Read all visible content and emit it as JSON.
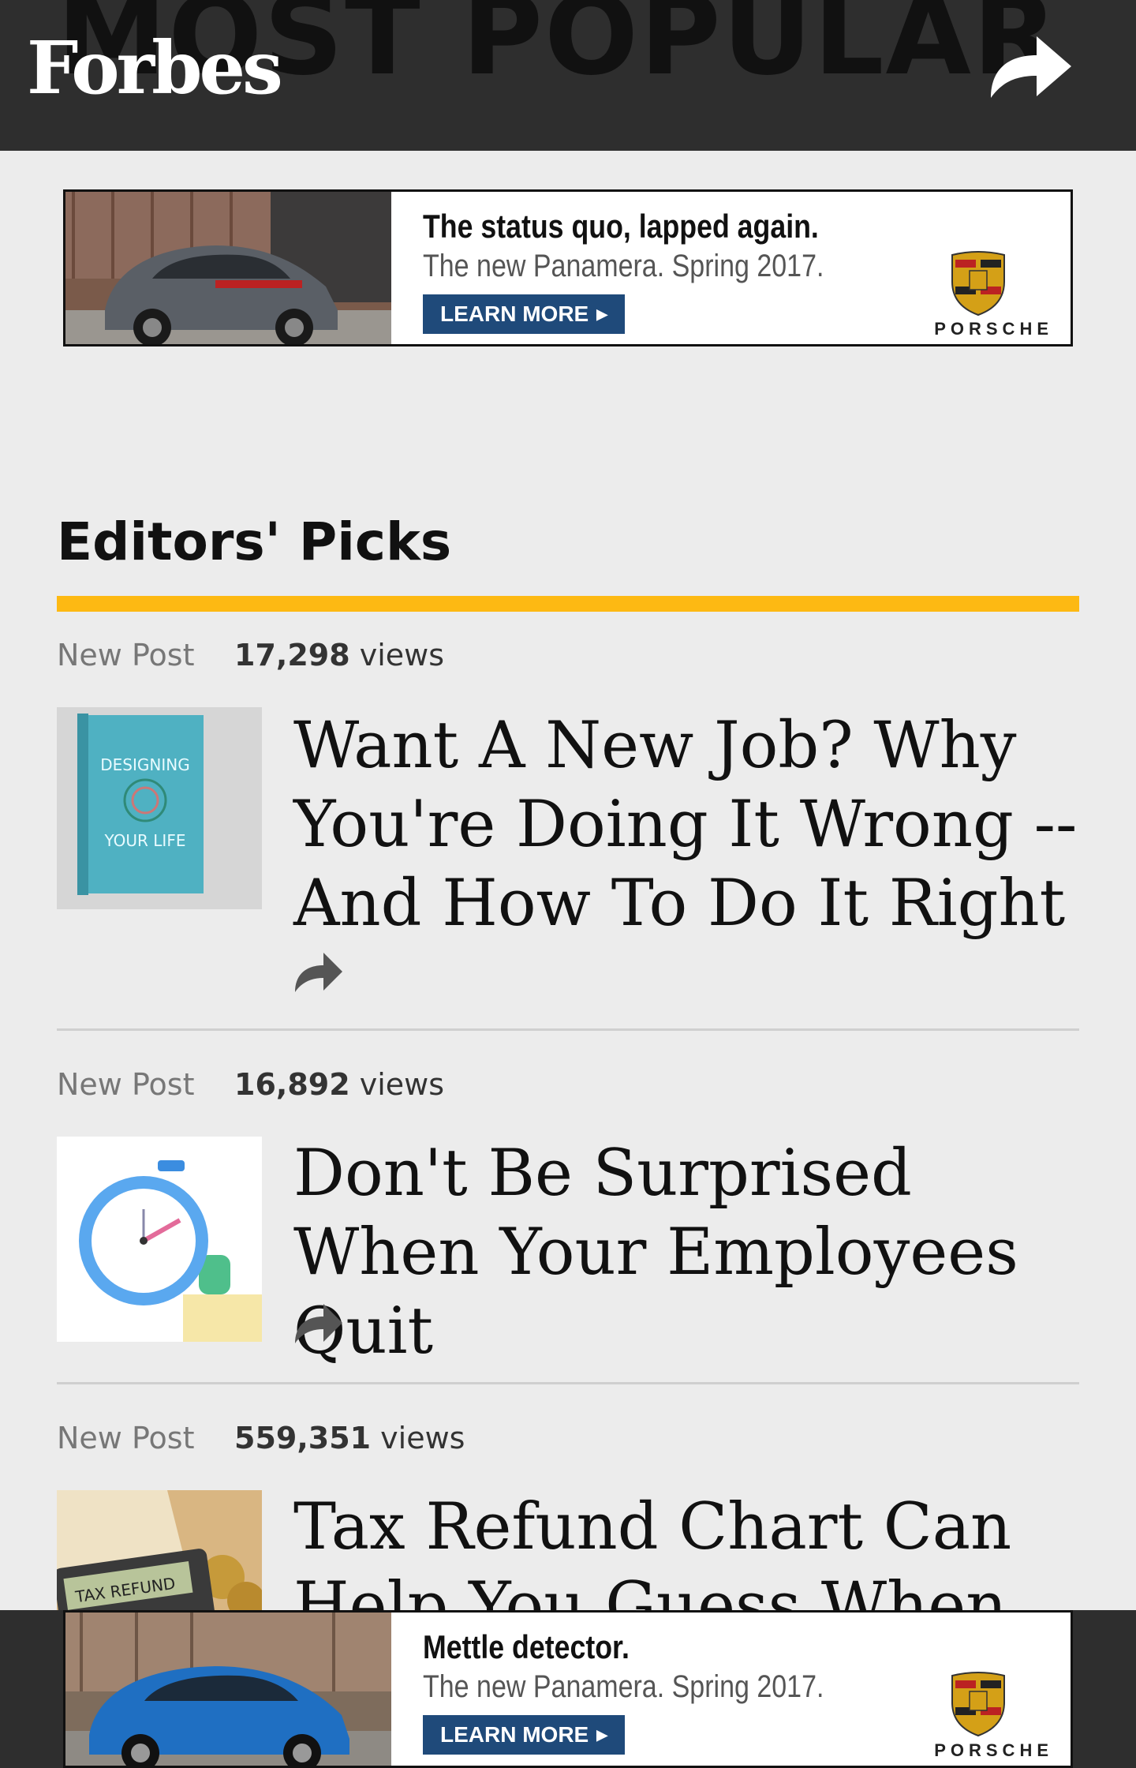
{
  "header": {
    "background_title": "MOST POPULAR",
    "logo": "Forbes",
    "share_icon": "share-arrow-icon"
  },
  "ads": [
    {
      "headline": "The status quo, lapped again.",
      "subline": "The new Panamera. Spring 2017.",
      "cta": "LEARN MORE",
      "brand": "PORSCHE",
      "car_color": "#5a5f66"
    },
    {
      "headline": "Mettle detector.",
      "subline": "The new Panamera. Spring 2017.",
      "cta": "LEARN MORE",
      "brand": "PORSCHE",
      "car_color": "#1f6fc2"
    }
  ],
  "editors_picks": {
    "title": "Editors' Picks",
    "accent_color": "#fdb913",
    "articles": [
      {
        "label": "New Post",
        "views_count": "17,298",
        "views_word": "views",
        "headline": "Want A New Job? Why You're Doing It Wrong -- And How To Do It Right",
        "thumb_icon": "book-cover-icon",
        "thumb_text_1": "DESIGNING",
        "thumb_text_2": "YOUR LIFE"
      },
      {
        "label": "New Post",
        "views_count": "16,892",
        "views_word": "views",
        "headline": "Don't Be Surprised When Your Employees Quit",
        "thumb_icon": "stopwatch-icon"
      },
      {
        "label": "New Post",
        "views_count": "559,351",
        "views_word": "views",
        "headline": "Tax Refund Chart Can Help You Guess When",
        "thumb_icon": "tax-refund-calculator-icon",
        "thumb_text_1": "TAX REFUND"
      }
    ]
  }
}
